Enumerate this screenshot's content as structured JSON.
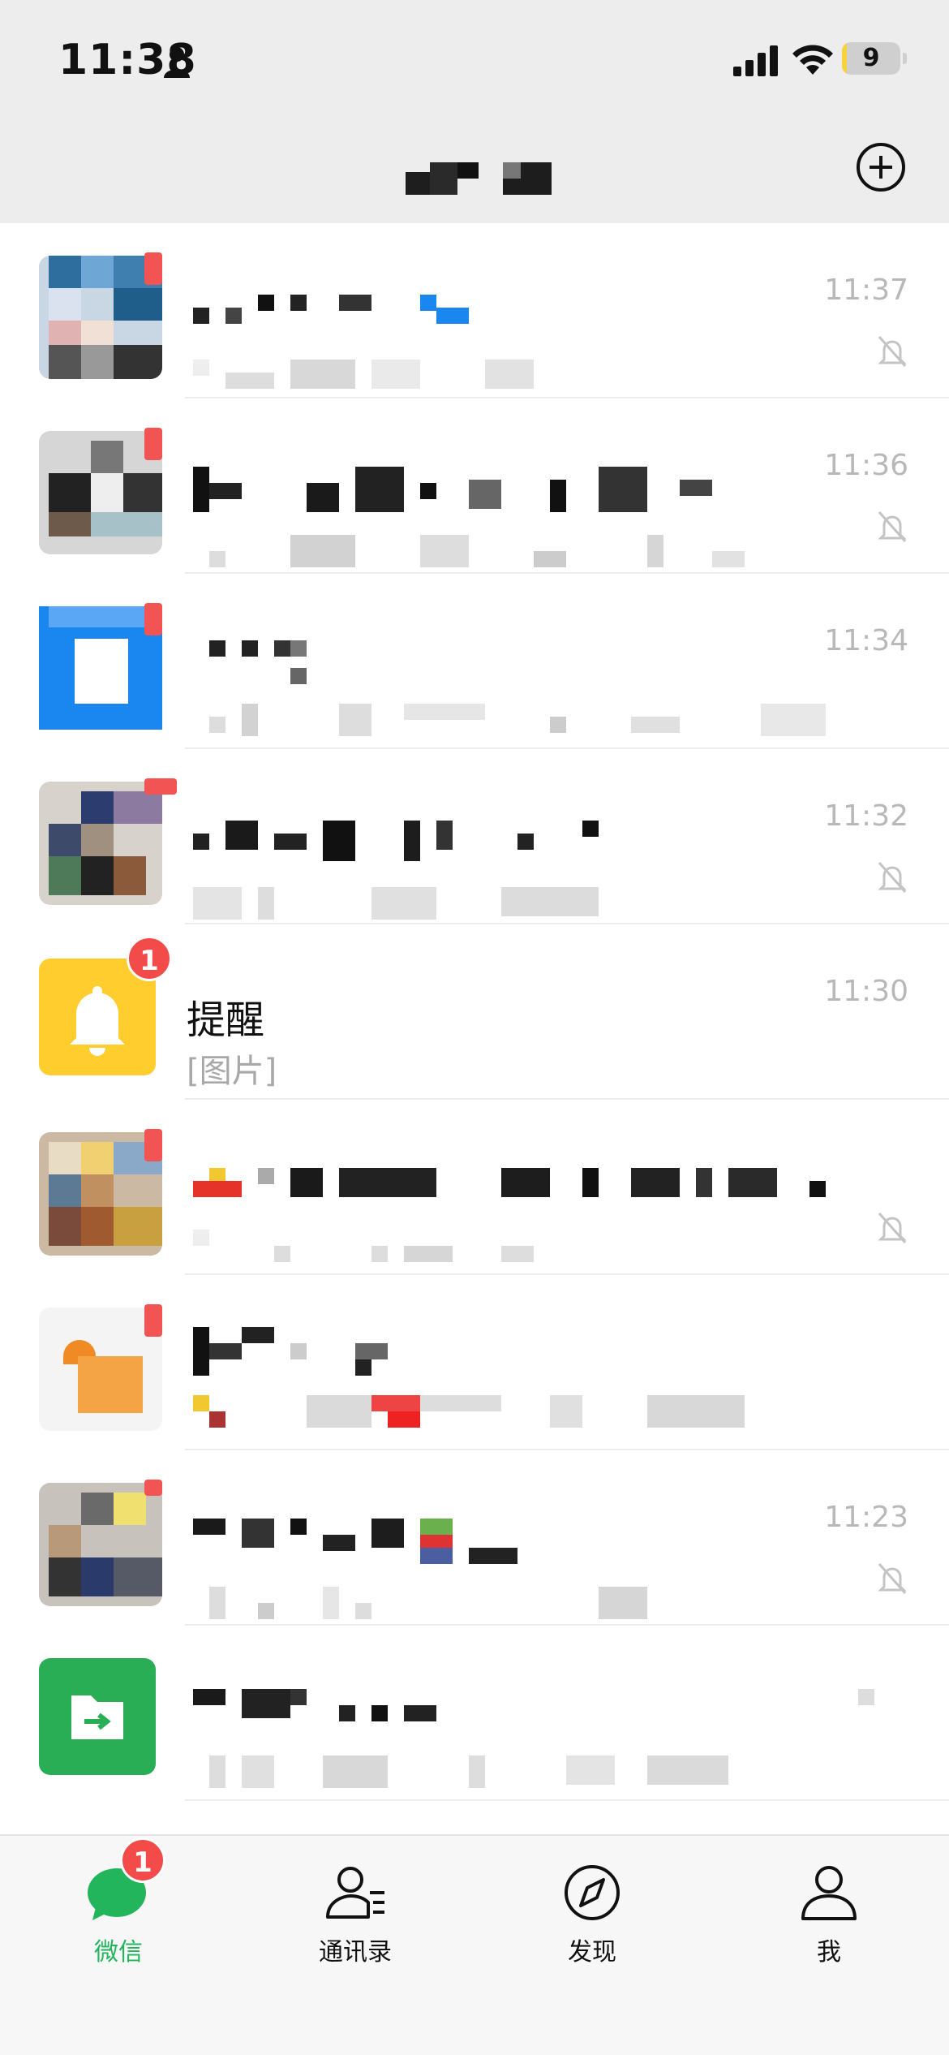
{
  "status_bar": {
    "time": "11:38",
    "battery_level": "9",
    "battery_fraction": 0.09,
    "icons": [
      "person-icon",
      "signal-icon",
      "wifi-icon",
      "battery-icon"
    ]
  },
  "header": {
    "title": "",
    "add_icon": "plus-circle-icon"
  },
  "chats": [
    {
      "name": "",
      "preview": "",
      "time": "11:37",
      "muted": true,
      "unread_dot": true
    },
    {
      "name": "",
      "preview": "",
      "time": "11:36",
      "muted": true,
      "unread_dot": true
    },
    {
      "name": "",
      "preview": "",
      "time": "11:34",
      "muted": false,
      "unread_dot": true
    },
    {
      "name": "",
      "preview": "",
      "time": "11:32",
      "muted": true,
      "unread_dot": true
    },
    {
      "name": "提醒",
      "preview": "[图片]",
      "time": "11:30",
      "muted": false,
      "unread_count": "1"
    },
    {
      "name": "",
      "preview": "",
      "time": "",
      "muted": true,
      "unread_dot": true
    },
    {
      "name": "",
      "preview": "",
      "time": "",
      "muted": false,
      "unread_dot": true
    },
    {
      "name": "",
      "preview": "",
      "time": "11:23",
      "muted": true,
      "unread_dot": true
    },
    {
      "name": "",
      "preview": "",
      "time": "",
      "muted": false,
      "unread_dot": false
    }
  ],
  "tabs": [
    {
      "label": "微信",
      "icon": "chat-bubble-icon",
      "active": true,
      "badge": "1"
    },
    {
      "label": "通讯录",
      "icon": "contacts-icon",
      "active": false
    },
    {
      "label": "发现",
      "icon": "compass-icon",
      "active": false
    },
    {
      "label": "我",
      "icon": "person-icon",
      "active": false
    }
  ],
  "colors": {
    "accent_green": "#22b55c",
    "badge_red": "#f34a4a",
    "reminder_yellow": "#ffcd2e",
    "file_green": "#2aae55",
    "blue_app": "#1a86f0"
  }
}
